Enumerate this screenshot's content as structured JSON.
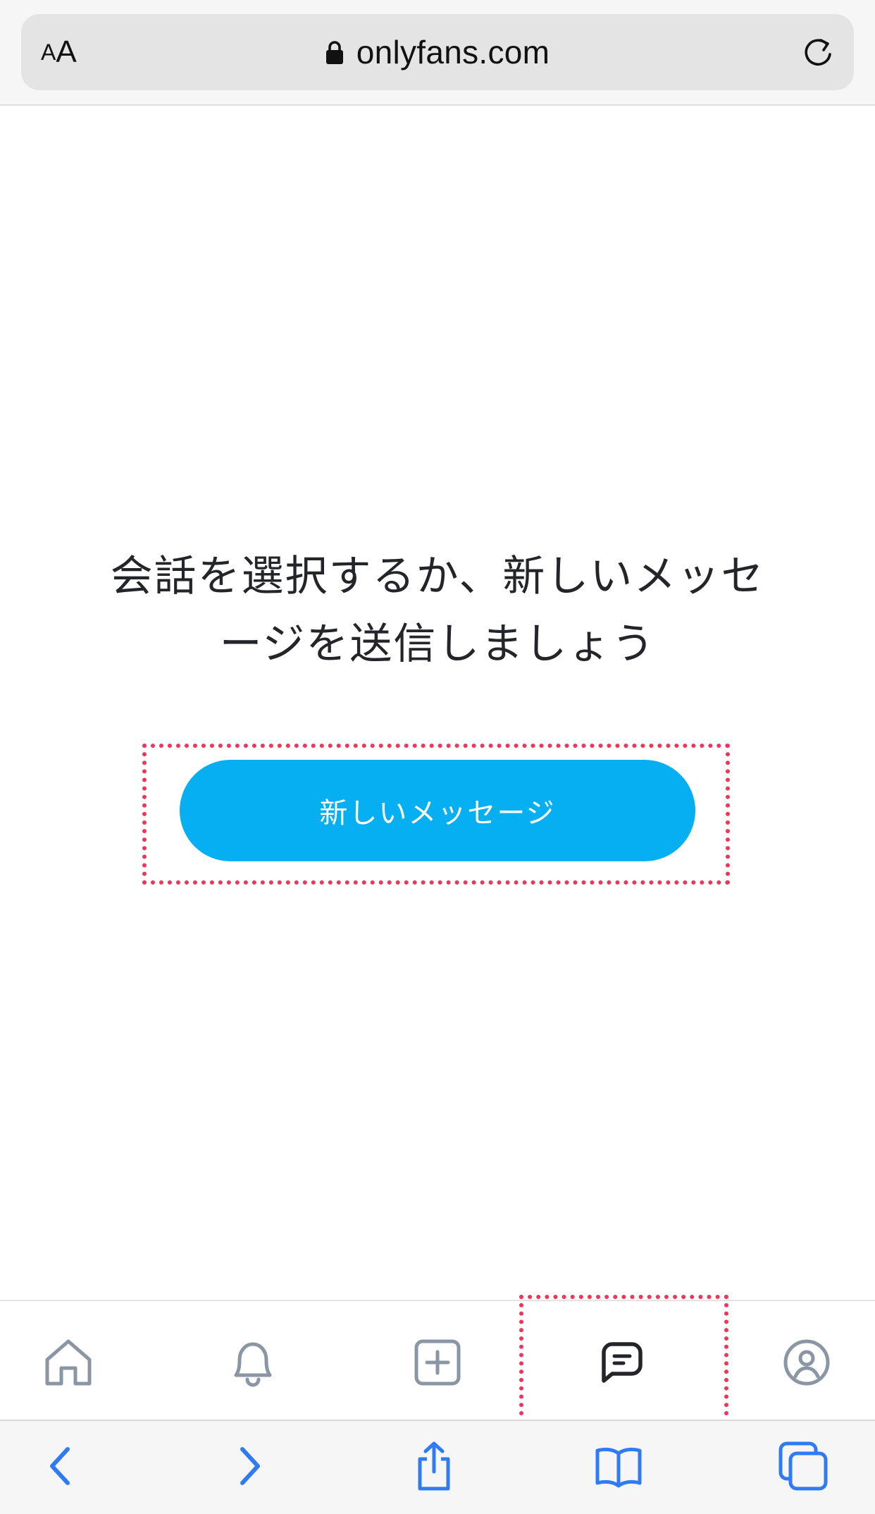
{
  "browser": {
    "text_size_small": "A",
    "text_size_large": "A",
    "url": "onlyfans.com",
    "lock_icon": "lock-icon",
    "reload_icon": "reload-icon"
  },
  "main": {
    "empty_state_line1": "会話を選択するか、新しいメッセ",
    "empty_state_line2": "ージを送信しましょう",
    "new_message_label": "新しいメッセージ"
  },
  "app_nav": {
    "items": [
      {
        "icon": "home-icon"
      },
      {
        "icon": "bell-icon"
      },
      {
        "icon": "plus-square-icon"
      },
      {
        "icon": "message-icon",
        "active": true
      },
      {
        "icon": "profile-icon"
      }
    ]
  },
  "safari_toolbar": {
    "items": [
      {
        "icon": "chevron-left-icon"
      },
      {
        "icon": "chevron-right-icon"
      },
      {
        "icon": "share-icon"
      },
      {
        "icon": "bookmarks-icon"
      },
      {
        "icon": "tabs-icon"
      }
    ]
  },
  "colors": {
    "accent": "#05aff1",
    "highlight": "#f0345a",
    "ios_blue": "#2f7bf5",
    "nav_gray": "#8a96a3",
    "text": "#242529"
  }
}
